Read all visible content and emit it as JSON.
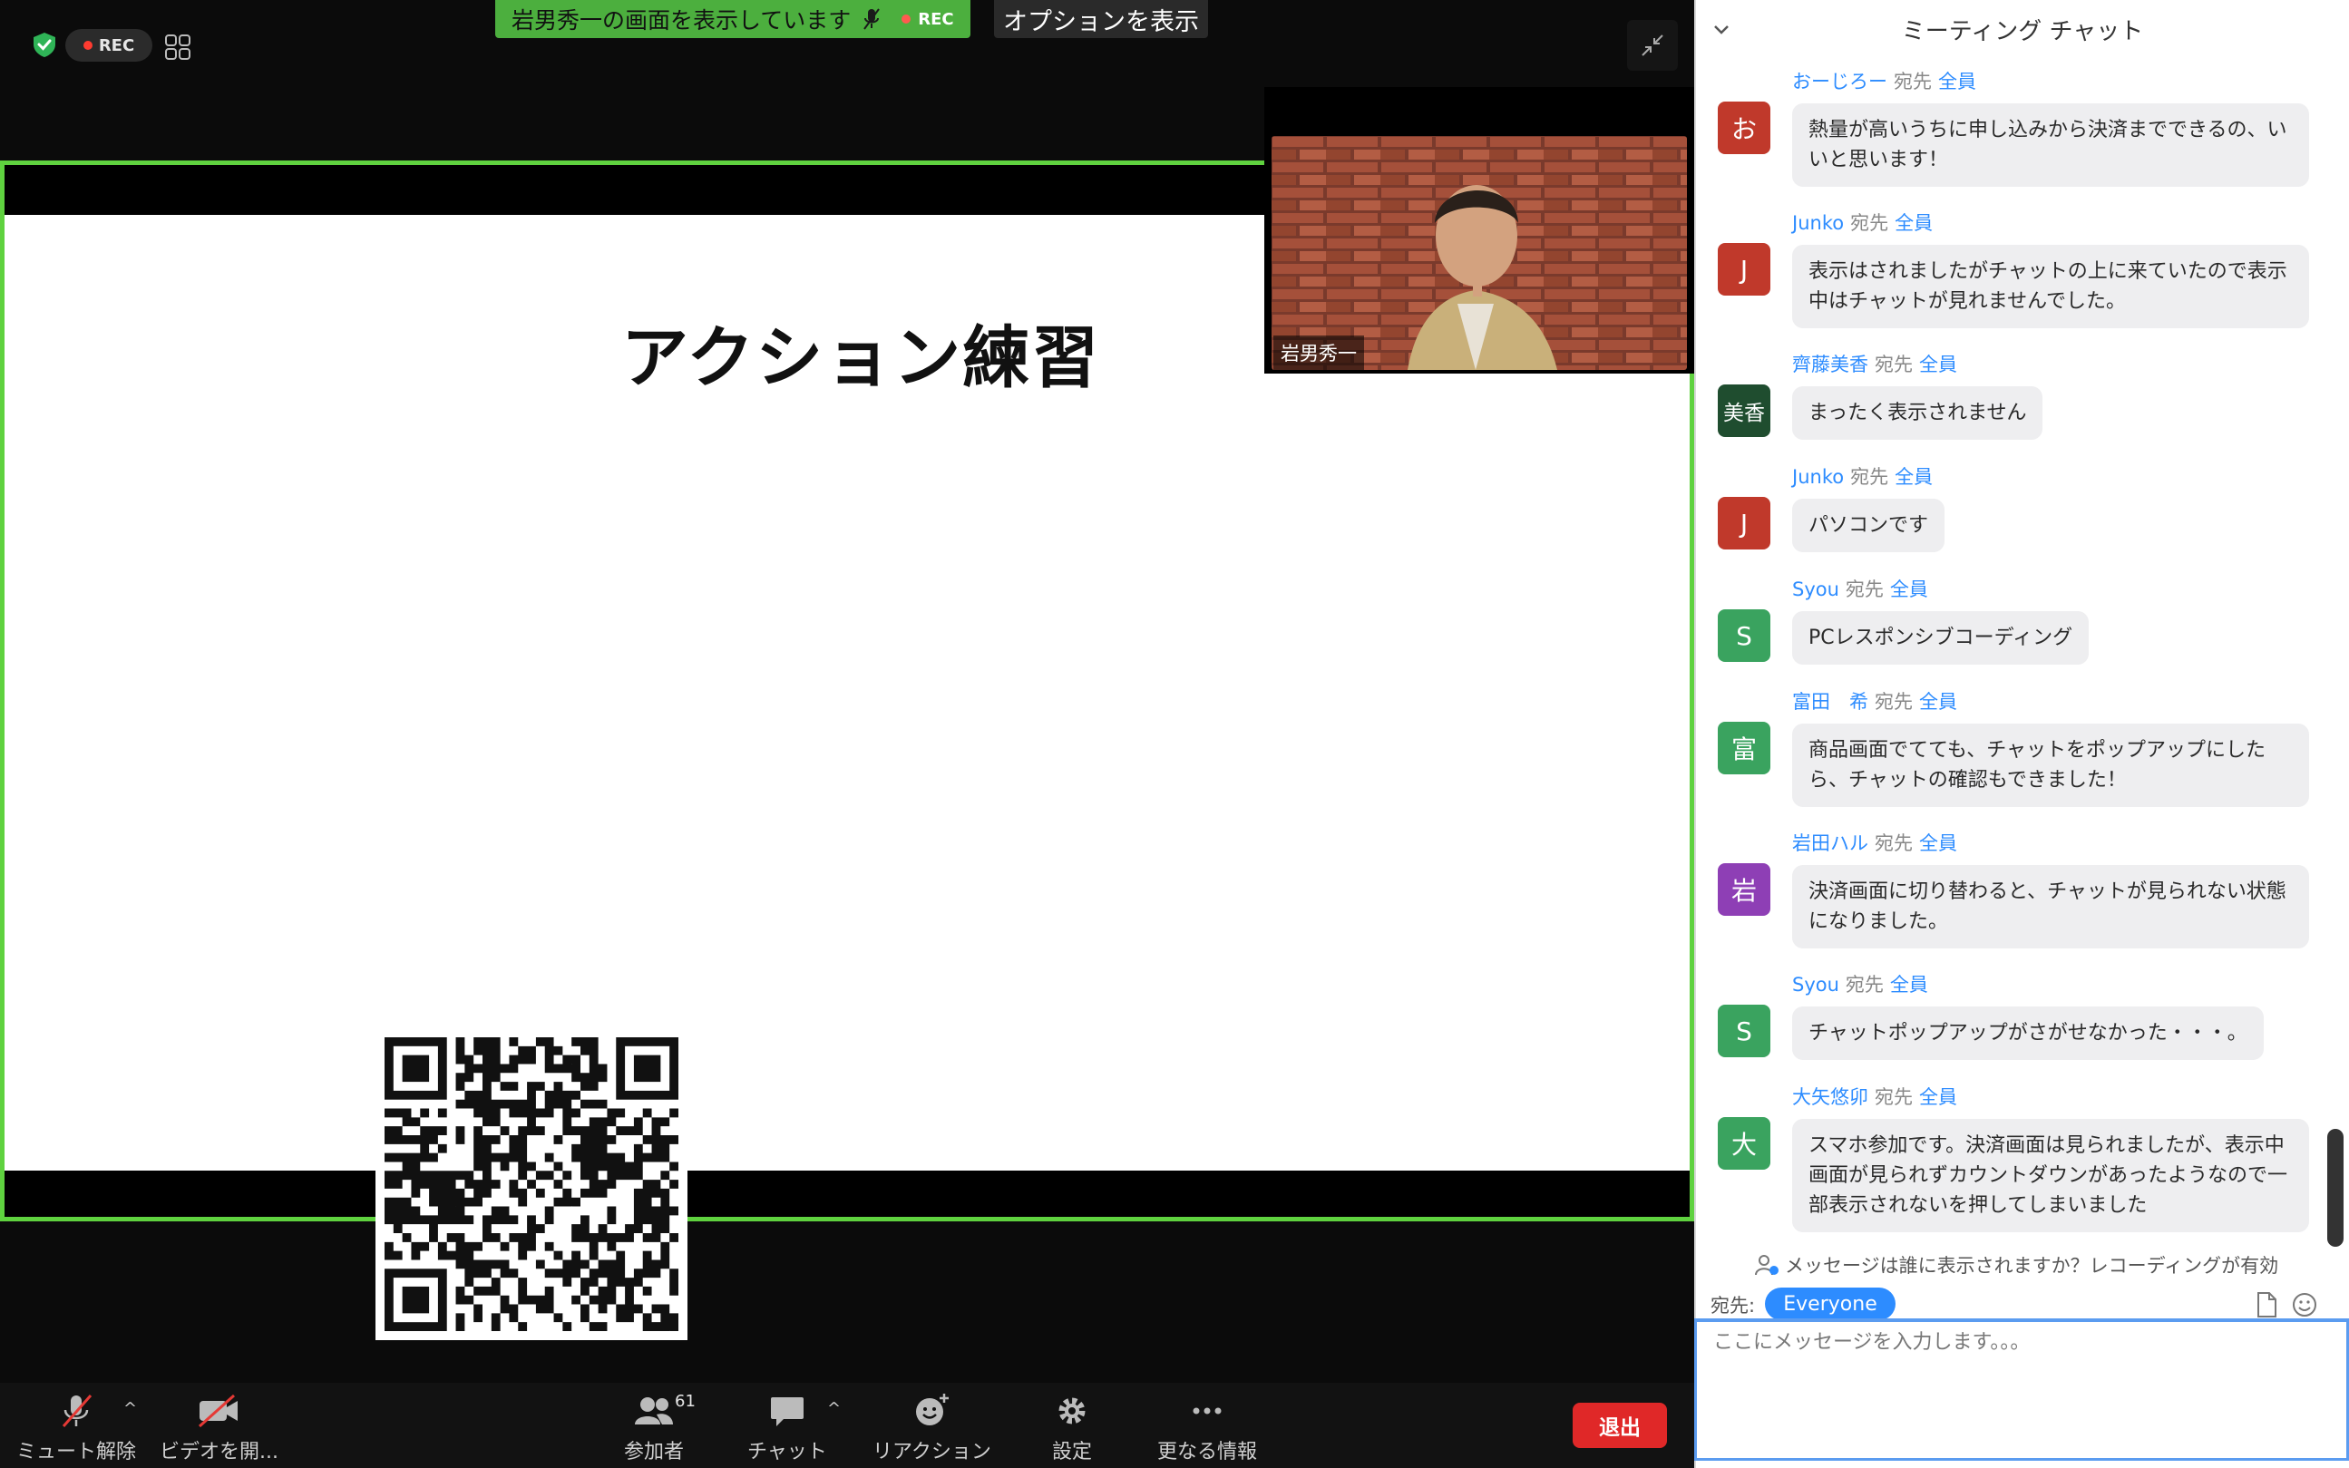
{
  "top": {
    "rec_label": "REC",
    "share_banner_text": "岩男秀一の画面を表示しています",
    "banner_rec_label": "REC",
    "options_label": "オプションを表示"
  },
  "slide": {
    "title": "アクション練習"
  },
  "video": {
    "participant_name": "岩男秀一"
  },
  "toolbar": {
    "unmute_label": "ミュート解除",
    "video_label": "ビデオを開...",
    "participants_label": "参加者",
    "participants_count": "61",
    "chat_label": "チャット",
    "reactions_label": "リアクション",
    "settings_label": "設定",
    "more_label": "更なる情報",
    "leave_label": "退出"
  },
  "chat": {
    "title": "ミーティング チャット",
    "to_word": "宛先",
    "messages": [
      {
        "sender": "おーじろー",
        "target": "全員",
        "avatar": "お",
        "color": "#c0392b",
        "text": "熱量が高いうちに申し込みから決済までできるの、いいと思います！"
      },
      {
        "sender": "Junko",
        "target": "全員",
        "avatar": "J",
        "color": "#c0392b",
        "text": "表示はされましたがチャットの上に来ていたので表示中はチャットが見れませんでした。"
      },
      {
        "sender": "齊藤美香",
        "target": "全員",
        "avatar": "美香",
        "color": "#1f4d2f",
        "text": "まったく表示されません"
      },
      {
        "sender": "Junko",
        "target": "全員",
        "avatar": "J",
        "color": "#c0392b",
        "text": "パソコンです"
      },
      {
        "sender": "Syou",
        "target": "全員",
        "avatar": "S",
        "color": "#3aa35f",
        "text": "PCレスポンシブコーディング"
      },
      {
        "sender": "富田　希",
        "target": "全員",
        "avatar": "富",
        "color": "#3aa35f",
        "text": "商品画面でてても、チャットをポップアップにしたら、チャットの確認もできました！"
      },
      {
        "sender": "岩田ハル",
        "target": "全員",
        "avatar": "岩",
        "color": "#8e3fb5",
        "text": "決済画面に切り替わると、チャットが見られない状態になりました。"
      },
      {
        "sender": "Syou",
        "target": "全員",
        "avatar": "S",
        "color": "#3aa35f",
        "text": "チャットポップアップがさがせなかった・・・。"
      },
      {
        "sender": "大矢悠卯",
        "target": "全員",
        "avatar": "大",
        "color": "#3aa35f",
        "text": "スマホ参加です。決済画面は見られましたが、表示中画面が見られずカウントダウンがあったようなので一部表示されないを押してしまいました"
      }
    ],
    "visibility_note": "メッセージは誰に表示されますか？レコーディングが有効",
    "to_label": "宛先:",
    "to_value": "Everyone",
    "input_placeholder": "ここにメッセージを入力します。。。"
  }
}
